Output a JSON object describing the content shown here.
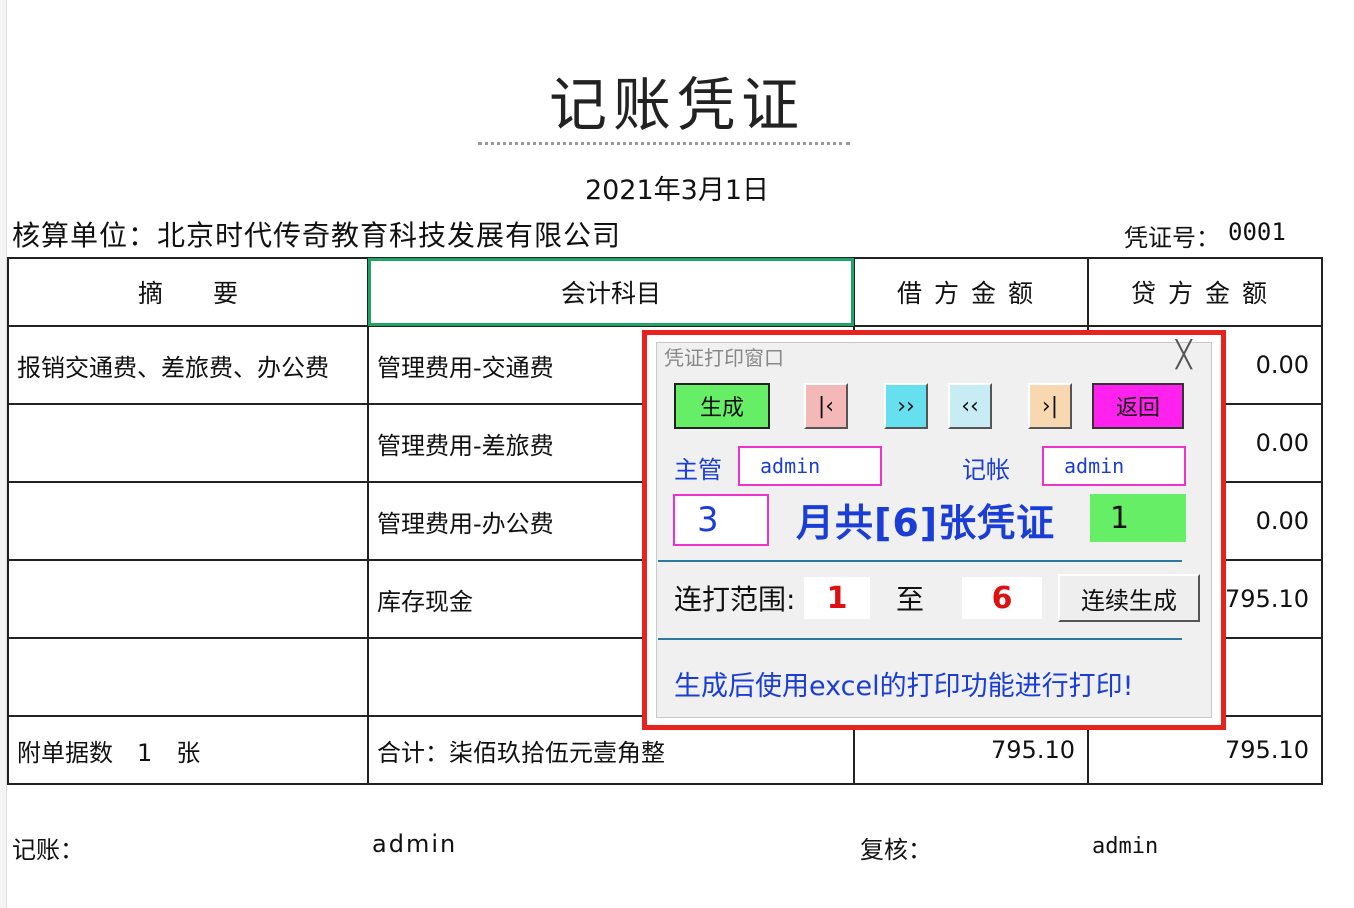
{
  "voucher": {
    "title": "记账凭证",
    "date": "2021年3月1日",
    "unit": "核算单位：北京时代传奇教育科技发展有限公司",
    "voucher_no_label": "凭证号：",
    "voucher_no": "0001",
    "columns": [
      "摘　　要",
      "会计科目",
      "借方金额",
      "贷方金额"
    ],
    "rows": [
      {
        "summary": "报销交通费、差旅费、办公费",
        "account": "管理费用-交通费",
        "debit": "",
        "credit": "0.00"
      },
      {
        "summary": "",
        "account": "管理费用-差旅费",
        "debit": "",
        "credit": "0.00"
      },
      {
        "summary": "",
        "account": "管理费用-办公费",
        "debit": "",
        "credit": "0.00"
      },
      {
        "summary": "",
        "account": "库存现金",
        "debit": "",
        "credit": "795.10"
      },
      {
        "summary": "",
        "account": "",
        "debit": "",
        "credit": ""
      }
    ],
    "attachments": "附单据数　1　张",
    "total_text": "合计：柒佰玖拾伍元壹角整",
    "total_debit": "795.10",
    "total_credit": "795.10",
    "bookkeeper_label": "记账：",
    "bookkeeper_value": "admin",
    "reviewer_label": "复核：",
    "reviewer_value": "admin"
  },
  "dialog": {
    "title": "凭证打印窗口",
    "close_glyph": "╳",
    "generate": "生成",
    "first": "|‹",
    "next": "››",
    "prev": "‹‹",
    "last": "›|",
    "return": "返回",
    "supervisor_label": "主管",
    "supervisor_value": "admin",
    "bookkeeper_label": "记帐",
    "bookkeeper_value": "admin",
    "month": "3",
    "month_text": "月共[6]张凭证",
    "current": "1",
    "range_label": "连打范围:",
    "range_from": "1",
    "range_to_label": "至",
    "range_to": "6",
    "batch_generate": "连续生成",
    "hint": "生成后使用excel的打印功能进行打印!"
  },
  "colors": {
    "highlight_frame": "#e8231f",
    "selection": "#21a366",
    "accent_blue": "#1a3dd8"
  }
}
